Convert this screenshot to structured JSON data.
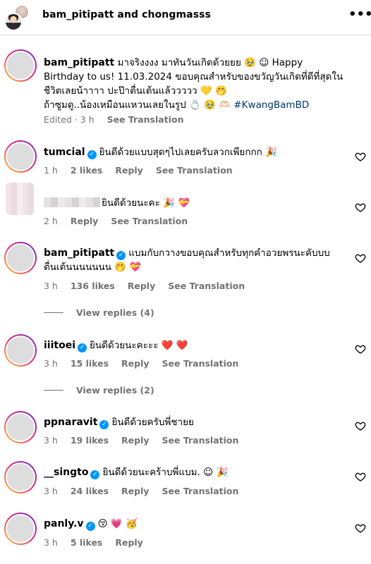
{
  "header": {
    "title": "bam_pitipatt and chongmasss",
    "more_icon": "more-horizontal-icon"
  },
  "caption": {
    "username": "bam_pitipatt",
    "line1": "มาจริงงงง มาทันวันเกิดด้วยยย 🥹 ☺︎ Happy",
    "line2": "Birthday to us! 11.03.2024 ขอบคุณสำหรับของขวัญวันเกิดที่ดีที่สุดใน",
    "line3": "ชีวิตเลยน้าาาา ปะป๊าตื่นเต้นแล้ววววว 💛 🤭",
    "line4": "ถ้าซูมดู..น้องเหมือนแหวนเลยในรูป 💍 🥹 🫶🏻",
    "hashtag": "#KwangBamBD",
    "edited": "Edited · 3 h",
    "see_translation": "See Translation"
  },
  "comments": [
    {
      "username": "tumcial",
      "verified": true,
      "text": "ยินดีด้วยแบบสุดๆไปเลยครับลวกเพียกกก 🎉",
      "time": "1 h",
      "likes": "2 likes",
      "reply": "Reply",
      "translate": "See Translation"
    },
    {
      "username": "",
      "verified": false,
      "text": "ยินดีด้วยนะคะ 🎉 💝",
      "time": "2 h",
      "likes": "",
      "reply": "Reply",
      "translate": "See Translation"
    },
    {
      "username": "bam_pitipatt",
      "verified": true,
      "text": "แบมกับกวางขอบคุณสำหรับทุกคำอวยพรนะคับบบ",
      "text2": "ตื่นเต้นนนนนนน 🤭 💝",
      "time": "3 h",
      "likes": "136 likes",
      "reply": "Reply",
      "translate": "See Translation",
      "replies": "View replies (4)"
    },
    {
      "username": "iiitoei",
      "verified": true,
      "text": "ยินดีด้วยนะคะะะ ❤️ ❤️",
      "time": "3 h",
      "likes": "15 likes",
      "reply": "Reply",
      "translate": "See Translation",
      "replies": "View replies (2)"
    },
    {
      "username": "ppnaravit",
      "verified": true,
      "text": "ยินดีด้วยครับพี่ชายย",
      "time": "3 h",
      "likes": "19 likes",
      "reply": "Reply",
      "translate": "See Translation"
    },
    {
      "username": "__singto",
      "verified": true,
      "text": "ยินดีด้วยนะคร้าบพี่แบม. ☺︎ 🎉",
      "time": "3 h",
      "likes": "24 likes",
      "reply": "Reply",
      "translate": "See Translation"
    },
    {
      "username": "panly.v",
      "verified": true,
      "text": "😚 💗 🥳",
      "time": "3 h",
      "likes": "5 likes",
      "reply": "Reply"
    }
  ],
  "colors": {
    "accent": "#0095f6",
    "meta": "#737373",
    "hashtag": "#00376b"
  }
}
